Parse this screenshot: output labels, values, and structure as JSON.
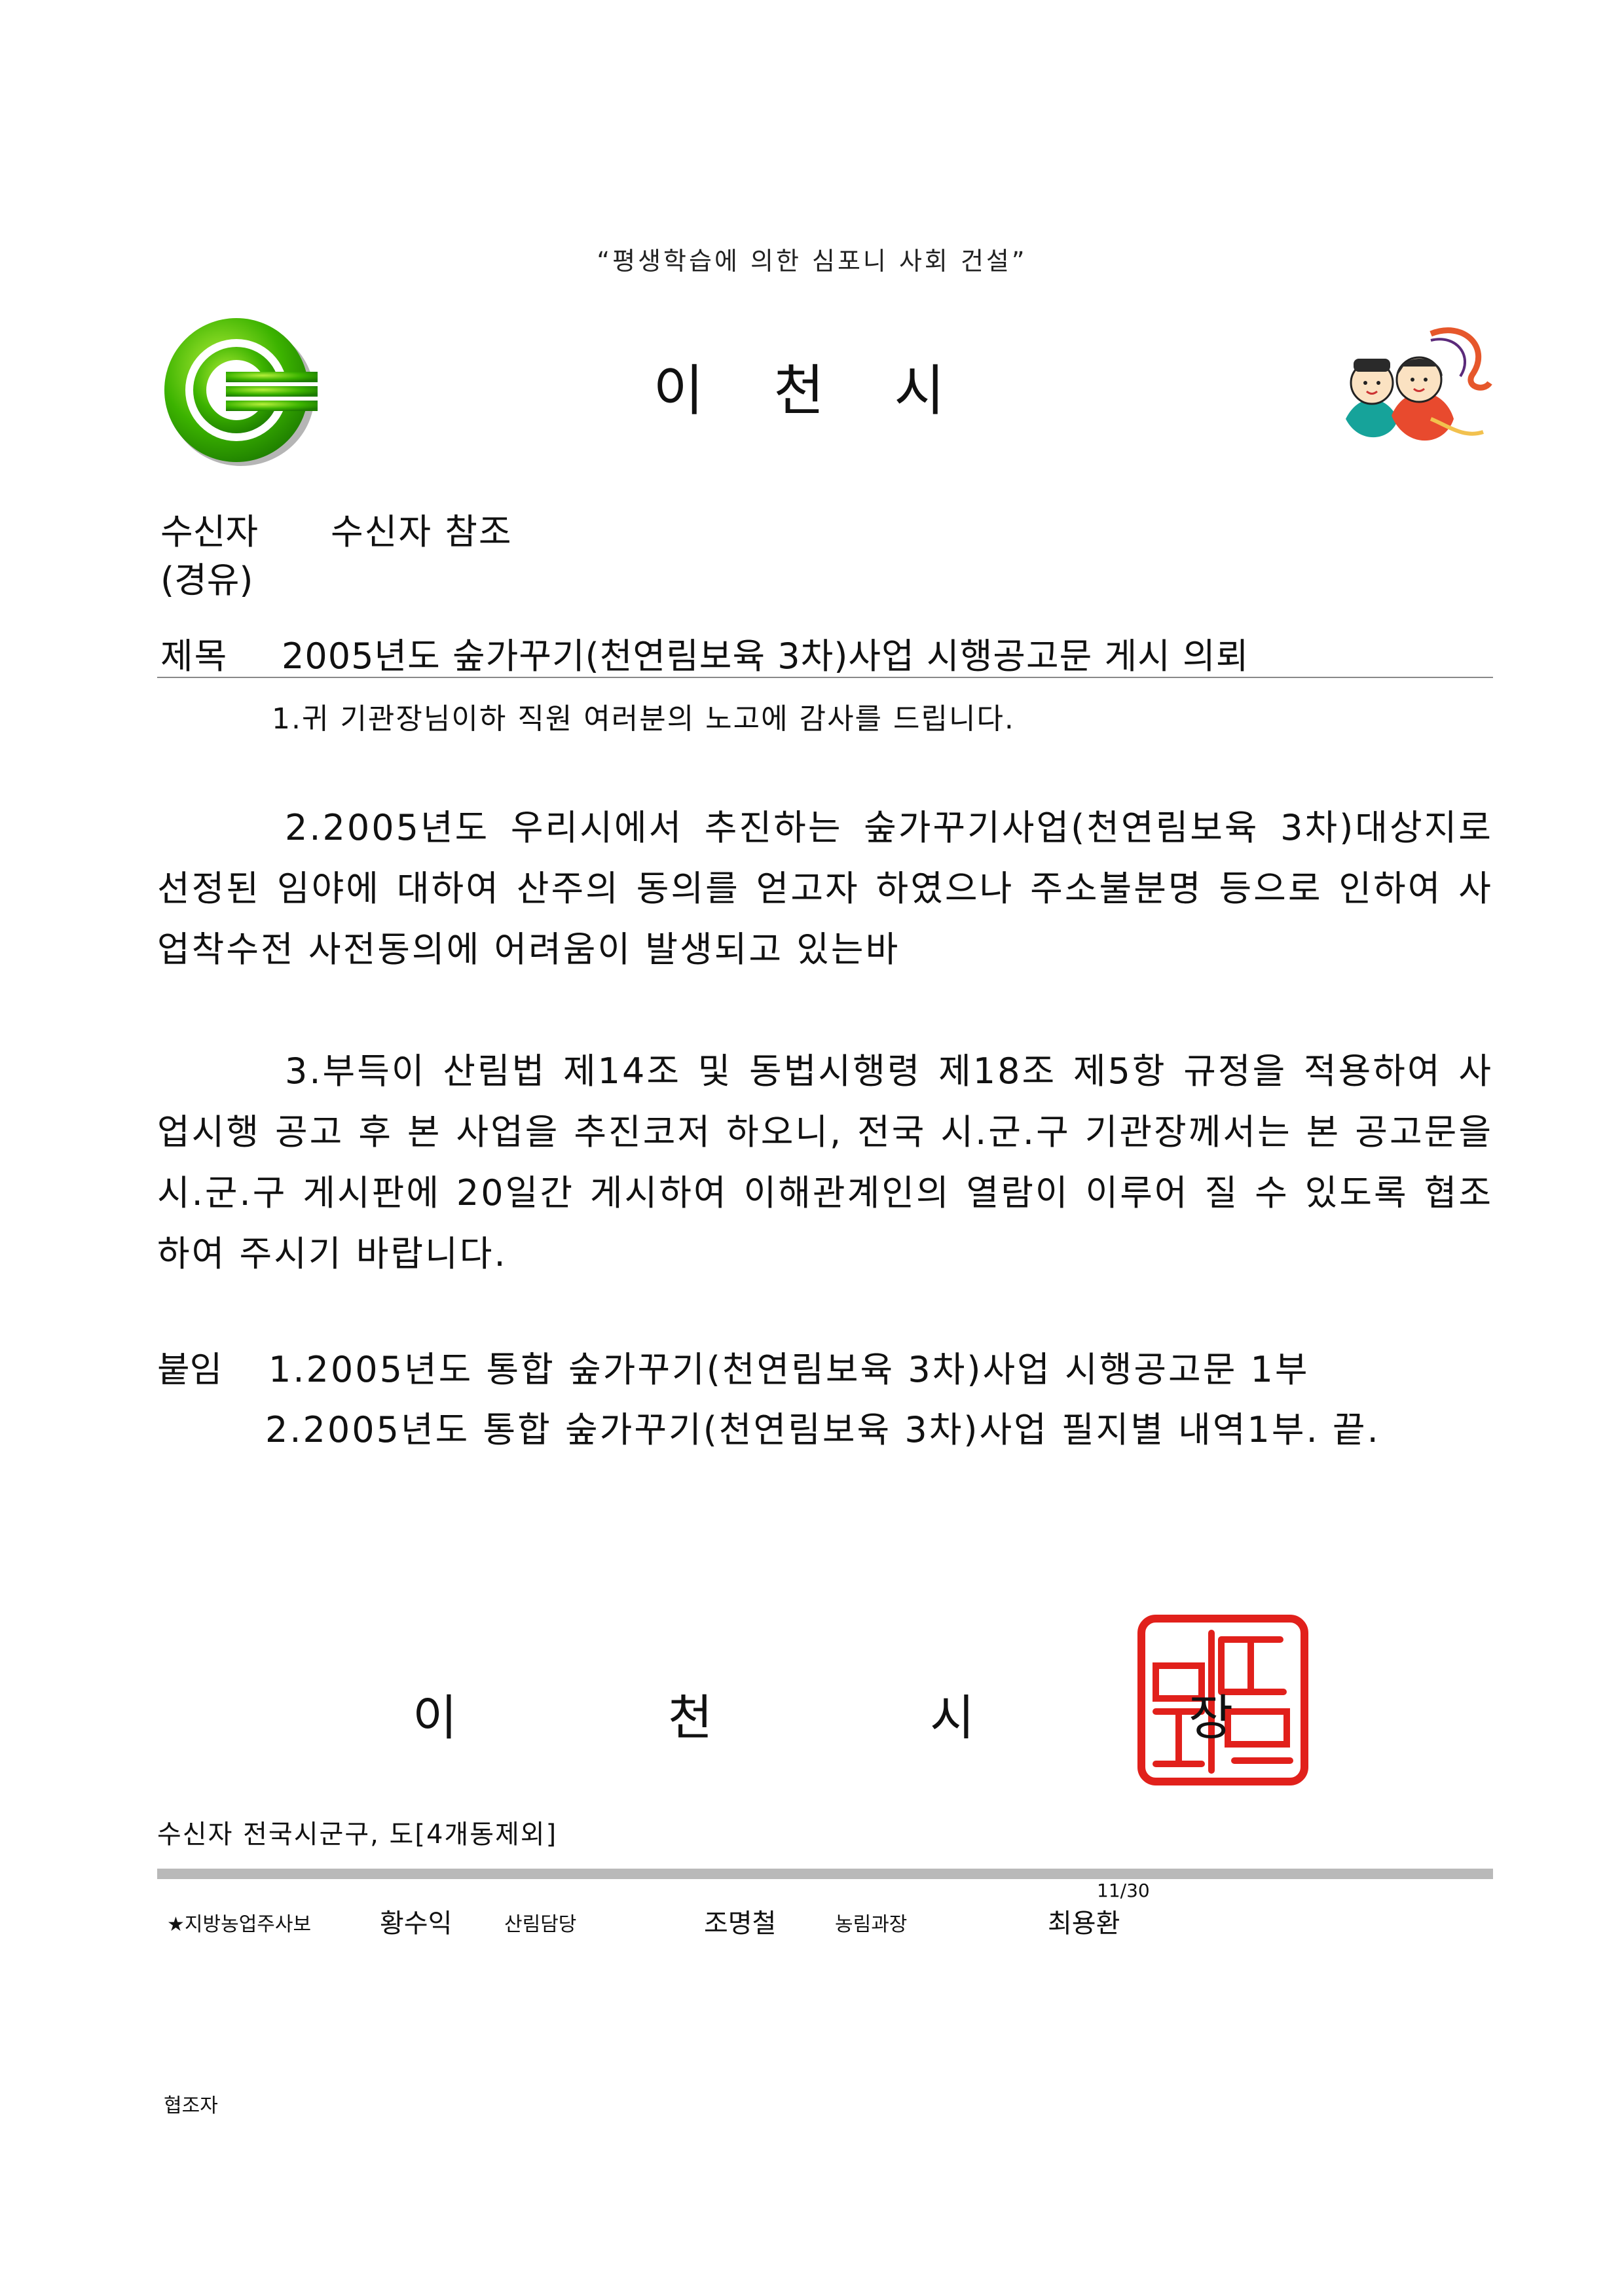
{
  "header": {
    "motto": "“평생학습에 의한 심포니 사회 건설”",
    "org_title": "이 천 시"
  },
  "recipient": {
    "label": "수신자",
    "value": "수신자 참조",
    "via": "(경유)"
  },
  "subject": {
    "label": "제목",
    "value": "2005년도 숲가꾸기(천연림보육 3차)사업 시행공고문 게시 의뢰"
  },
  "body": {
    "p1": "1.귀 기관장님이하 직원 여러분의 노고에 감사를 드립니다.",
    "p2": "2.2005년도 우리시에서 추진하는 숲가꾸기사업(천연림보육 3차)대상지로 선정된 임야에 대하여 산주의 동의를 얻고자 하였으나 주소불분명 등으로 인하여 사업착수전 사전동의에 어려움이 발생되고 있는바",
    "p3": "3.부득이 산림법 제14조 및 동법시행령 제18조 제5항 규정을 적용하여 사업시행 공고 후 본 사업을 추진코저 하오니, 전국 시.군.구 기관장께서는 본 공고문을 시.군.구 게시판에 20일간 게시하여 이해관계인의 열람이 이루어 질 수 있도록 협조하여 주시기 바랍니다."
  },
  "attachments": {
    "label": "붙임",
    "items": [
      "1.2005년도 통합 숲가꾸기(천연림보육 3차)사업 시행공고문 1부",
      "2.2005년도 통합 숲가꾸기(천연림보육 3차)사업 필지별 내역1부. 끝."
    ]
  },
  "issuer": {
    "chars": [
      "이",
      "천",
      "시",
      "장"
    ]
  },
  "footer": {
    "recipients_list": "수신자 전국시군구, 도[4개동제외]",
    "page_number": "11/30",
    "staff": [
      {
        "role": "★지방농업주사보",
        "name": "황수익"
      },
      {
        "role": "산림담당",
        "name": "조명철"
      },
      {
        "role": "농림과장",
        "name": "최용환"
      }
    ],
    "cooperator_label": "협조자"
  },
  "colors": {
    "logo_green": "#3cb300",
    "seal_red": "#e1201b",
    "bar_gray": "#b9b9b9"
  }
}
